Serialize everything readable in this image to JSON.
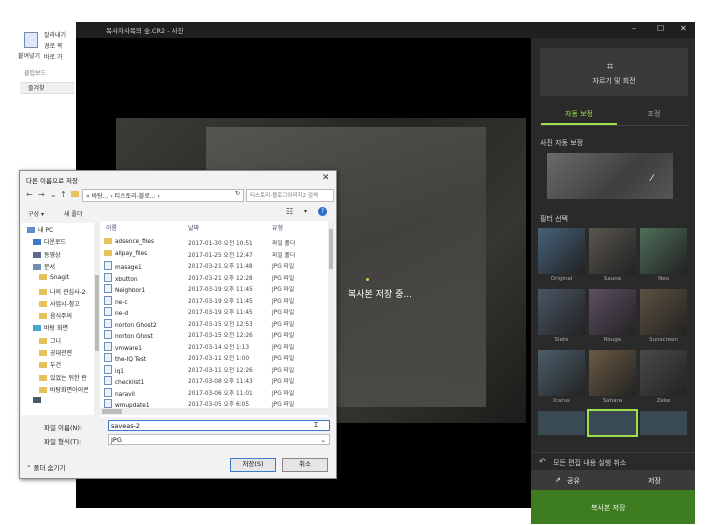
{
  "explorer": {
    "clipboard_items": [
      "잘라내기",
      "경로 복",
      "바로 가"
    ],
    "paste_label": "붙여넣기",
    "clipboard_group": "클립보드",
    "quick_item": "즐겨찾"
  },
  "photos": {
    "title": "목사자사목의 숲.CR2 - 사진",
    "saving_text": "복사본 저장 중...",
    "panel": {
      "crop_label": "자르기 및 회전",
      "tabs": [
        "자동 보정",
        "조정"
      ],
      "auto_enhance_title": "사진 자동 보정",
      "filter_title": "필터 선택",
      "filters": [
        {
          "name": "Original",
          "color": "#45617a"
        },
        {
          "name": "Sauna",
          "color": "#5a5650"
        },
        {
          "name": "Neo",
          "color": "#4e6f5a"
        },
        {
          "name": "Slate",
          "color": "#4a5566"
        },
        {
          "name": "Rouge",
          "color": "#5e4f63"
        },
        {
          "name": "Sunscreen",
          "color": "#5d5140"
        },
        {
          "name": "Icarus",
          "color": "#4a5e6b"
        },
        {
          "name": "Sahara",
          "color": "#6a5a44"
        },
        {
          "name": "Zeke",
          "color": "#4a4a4a"
        }
      ],
      "undo_label": "모든 편집 내용 실행 취소",
      "share_label": "공유",
      "save_label": "저장",
      "save_copy_label": "복사본 저장"
    }
  },
  "dialog": {
    "title": "다른 이름으로 저장",
    "path": "« 바탕... › 티스토리-블로... ›",
    "search_placeholder": "티스토리-블로그이미지2 검색",
    "organize_label": "구성 ▾",
    "new_folder_label": "새 폴더",
    "tree": [
      {
        "label": "내 PC",
        "icon": "pc",
        "indent": 0
      },
      {
        "label": "다운로드",
        "icon": "download",
        "indent": 1
      },
      {
        "label": "동영상",
        "icon": "video",
        "indent": 1
      },
      {
        "label": "문서",
        "icon": "doc",
        "indent": 1
      },
      {
        "label": "Snagit",
        "icon": "folder",
        "indent": 2
      },
      {
        "label": "나의 관심사-2",
        "icon": "folder",
        "indent": 2
      },
      {
        "label": "사업시-참고",
        "icon": "folder",
        "indent": 2
      },
      {
        "label": "음식주의",
        "icon": "folder",
        "indent": 2
      },
      {
        "label": "바탕 화면",
        "icon": "desktop",
        "indent": 1
      },
      {
        "label": "그니",
        "icon": "folder",
        "indent": 2
      },
      {
        "label": "공대관련",
        "icon": "folder",
        "indent": 2
      },
      {
        "label": "두건",
        "icon": "folder",
        "indent": 2
      },
      {
        "label": "있었는 뒤한 란",
        "icon": "folder",
        "indent": 2
      },
      {
        "label": "바탕화면아이콘",
        "icon": "folder",
        "indent": 2
      },
      {
        "label": "",
        "icon": "drive",
        "indent": 1
      }
    ],
    "columns": {
      "name": "이름",
      "date": "날짜",
      "type": "유형"
    },
    "files": [
      {
        "name": "adsence_files",
        "date": "2017-01-30 오전 10:51",
        "type": "파일 폴더",
        "kind": "folder"
      },
      {
        "name": "allpay_files",
        "date": "2017-01-25 오전 12:47",
        "type": "파일 폴더",
        "kind": "folder"
      },
      {
        "name": "masage1",
        "date": "2017-03-21 오후 11:48",
        "type": "JPG 파일",
        "kind": "jpg"
      },
      {
        "name": "xbutton",
        "date": "2017-03-21 오후 12:28",
        "type": "JPG 파일",
        "kind": "jpg"
      },
      {
        "name": "Neighbor1",
        "date": "2017-03-19 오후 11:45",
        "type": "JPG 파일",
        "kind": "jpg"
      },
      {
        "name": "ne-c",
        "date": "2017-03-19 오후 11:45",
        "type": "JPG 파일",
        "kind": "jpg"
      },
      {
        "name": "ne-d",
        "date": "2017-03-19 오후 11:45",
        "type": "JPG 파일",
        "kind": "jpg"
      },
      {
        "name": "norton Ghost2",
        "date": "2017-03-15 오전 12:53",
        "type": "JPG 파일",
        "kind": "jpg"
      },
      {
        "name": "norton Ghost",
        "date": "2017-03-15 오전 12:26",
        "type": "JPG 파일",
        "kind": "jpg"
      },
      {
        "name": "vmware1",
        "date": "2017-03-14 오전 1:13",
        "type": "JPG 파일",
        "kind": "jpg"
      },
      {
        "name": "the-IQ Test",
        "date": "2017-03-11 오전 1:00",
        "type": "JPG 파일",
        "kind": "jpg"
      },
      {
        "name": "iq1",
        "date": "2017-03-11 오전 12:26",
        "type": "JPG 파일",
        "kind": "jpg"
      },
      {
        "name": "checklist1",
        "date": "2017-03-08 오후 11:43",
        "type": "JPG 파일",
        "kind": "jpg"
      },
      {
        "name": "naravil",
        "date": "2017-03-06 오후 11:01",
        "type": "JPG 파일",
        "kind": "jpg"
      },
      {
        "name": "wmupdate1",
        "date": "2017-03-05 오후 6:05",
        "type": "JPG 파일",
        "kind": "jpg"
      }
    ],
    "filename_label": "파일 이름(N):",
    "filename_value": "saveas-2",
    "filetype_label": "파일 형식(T):",
    "filetype_value": "JPG",
    "hide_folders_label": "폴더 숨기기",
    "save_button": "저장(S)",
    "cancel_button": "취소"
  }
}
